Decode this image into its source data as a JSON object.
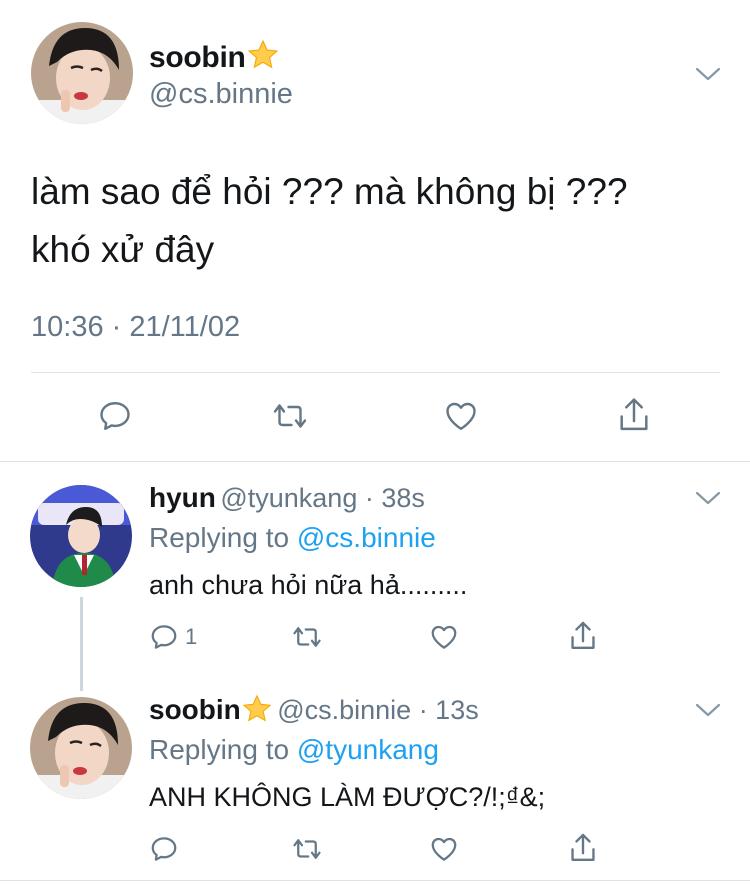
{
  "main_tweet": {
    "display_name": "soobin",
    "name_emoji": "star",
    "handle": "@cs.binnie",
    "text_lines": [
      "làm sao để hỏi ??? mà không bị ???",
      "khó xử đây"
    ],
    "timestamp": "10:36 · 21/11/02"
  },
  "replies": [
    {
      "display_name": "hyun",
      "handle_time": "@tyunkang · 38s",
      "replying_prefix": "Replying to",
      "replying_to": "@cs.binnie",
      "text": "anh chưa hỏi nữa hả.........",
      "reply_count": "1"
    },
    {
      "display_name": "soobin",
      "name_emoji": "star",
      "handle_time": "@cs.binnie · 13s",
      "replying_prefix": "Replying to",
      "replying_to": "@tyunkang",
      "text": "ANH KHÔNG LÀM ĐƯỢC?/!;₫&;"
    }
  ],
  "colors": {
    "text": "#14171a",
    "secondary": "#657786",
    "link": "#1da1f2",
    "divider": "#dfe3e7",
    "star": "#ffcc4d"
  },
  "icons": [
    "chevron-down-icon",
    "reply-icon",
    "retweet-icon",
    "like-icon",
    "share-icon",
    "star-icon"
  ]
}
